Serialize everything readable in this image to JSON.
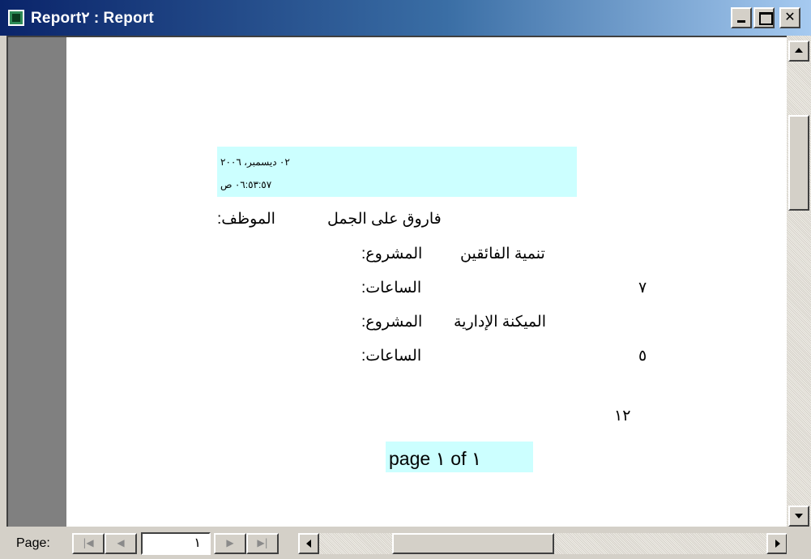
{
  "window": {
    "title": "Report٢ : Report"
  },
  "report": {
    "date": "٠٢ ديسمبر، ٢٠٠٦",
    "time": "٠٦:٥٣:٥٧ ص",
    "employee_label": "الموظف:",
    "employee_name": "فاروق على الجمل",
    "projects": [
      {
        "project_label": "المشروع:",
        "project_name": "تنمية الفائقين",
        "hours_label": "الساعات:",
        "hours_value": "٧"
      },
      {
        "project_label": "المشروع:",
        "project_name": "الميكنة الإدارية",
        "hours_label": "الساعات:",
        "hours_value": "٥"
      }
    ],
    "total_hours": "١٢",
    "page_footer": "page ١ of ١"
  },
  "navigation": {
    "page_label": "Page:",
    "current_page": "١",
    "first_icon": "first-page-icon",
    "prev_icon": "prev-page-icon",
    "next_icon": "next-page-icon",
    "last_icon": "last-page-icon"
  },
  "colors": {
    "title_gradient_start": "#0a246a",
    "title_gradient_end": "#a6caf0",
    "highlight": "#ccffff",
    "chrome": "#d4d0c8"
  }
}
